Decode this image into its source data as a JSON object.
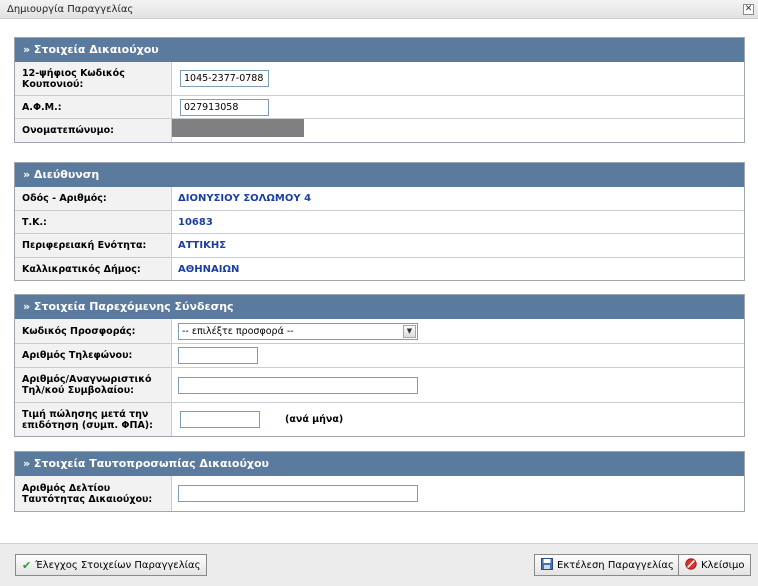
{
  "window": {
    "title": "Δημιουργία Παραγγελίας",
    "close_glyph": "✕"
  },
  "beneficiary": {
    "header": "» Στοιχεία Δικαιούχου",
    "coupon_label": "12-ψήφιος Κωδικός Κουπονιού:",
    "coupon_value": "1045-2377-0788",
    "afm_label": "Α.Φ.Μ.:",
    "afm_value": "027913058",
    "name_label": "Ονοματεπώνυμο:"
  },
  "address": {
    "header": "» Διεύθυνση",
    "street_label": "Οδός - Αριθμός:",
    "street_value": "ΔΙΟΝΥΣΙΟΥ ΣΟΛΩΜΟΥ 4",
    "zip_label": "Τ.Κ.:",
    "zip_value": "10683",
    "region_label": "Περιφερειακή Ενότητα:",
    "region_value": "ΑΤΤΙΚΗΣ",
    "municipality_label": "Καλλικρατικός Δήμος:",
    "municipality_value": "ΑΘΗΝΑΙΩΝ"
  },
  "connection": {
    "header": "» Στοιχεία Παρεχόμενης Σύνδεσης",
    "offer_label": "Κωδικός Προσφοράς:",
    "offer_selected": "-- επιλέξτε προσφορά --",
    "phone_label": "Αριθμός Τηλεφώνου:",
    "contract_label": "Αριθμός/Αναγνωριστικό Τηλ/κού Συμβολαίου:",
    "price_label": "Τιμή πώλησης μετά την επιδότηση (συμπ. ΦΠΑ):",
    "price_suffix": "(ανά μήνα)"
  },
  "identity": {
    "header": "» Στοιχεία Ταυτοπροσωπίας Δικαιούχου",
    "id_label": "Αριθμός Δελτίου Ταυτότητας Δικαιούχου:"
  },
  "footer": {
    "check_button": "Έλεγχος Στοιχείων Παραγγελίας",
    "execute_button": "Εκτέλεση Παραγγελίας",
    "close_button": "Κλείσιμο",
    "check_icon": "check-icon",
    "save_icon": "floppy-icon",
    "close_icon": "no-entry-icon"
  }
}
